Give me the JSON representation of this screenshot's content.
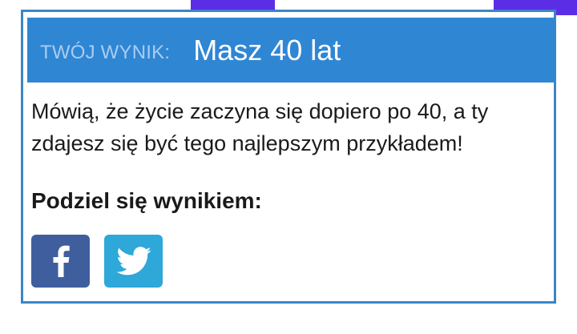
{
  "result": {
    "label": "TWÓJ WYNIK:",
    "title": "Masz 40 lat",
    "description": "Mówią, że życie zaczyna się dopiero po 40, a ty zdajesz się być tego najlepszym przykładem!"
  },
  "share": {
    "heading": "Podziel się wynikiem:",
    "buttons": [
      {
        "icon": "facebook-icon",
        "color": "#3e5e9e"
      },
      {
        "icon": "twitter-icon",
        "color": "#2ea7d9"
      }
    ]
  },
  "colors": {
    "header_bg": "#2f86d3",
    "header_label": "#a9cdf2",
    "card_border": "#3a86c9",
    "accent": "#5b2ee6"
  }
}
